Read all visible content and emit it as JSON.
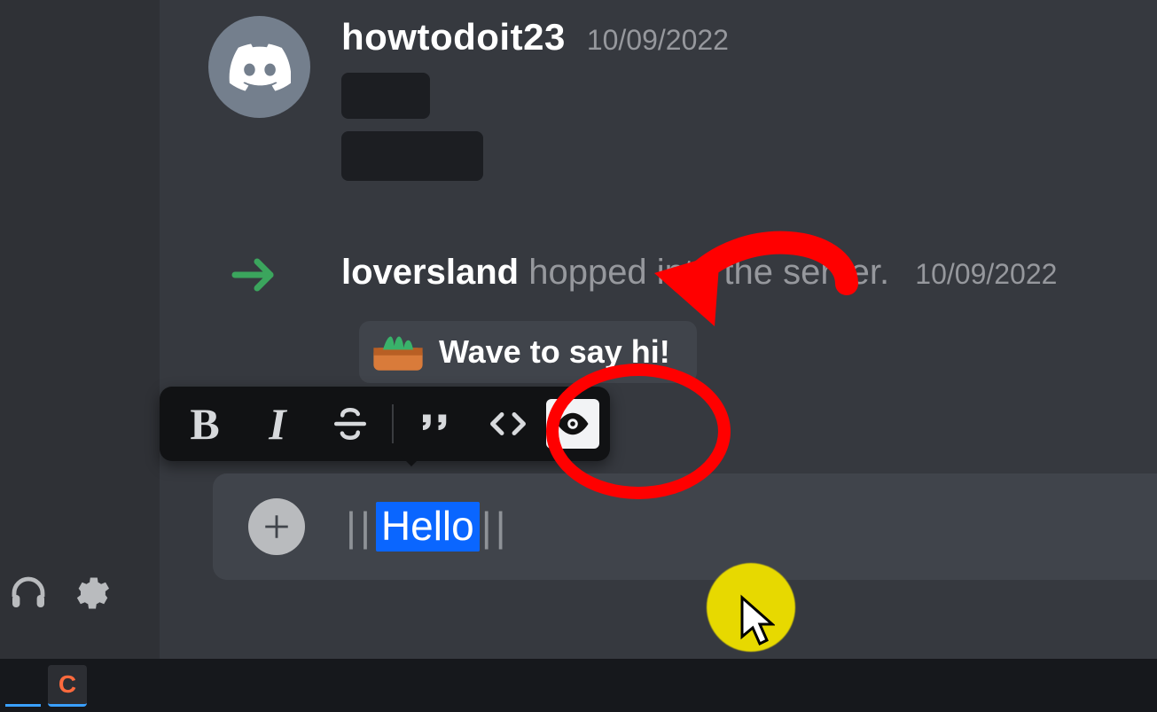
{
  "message1": {
    "username": "howtodoit23",
    "timestamp": "10/09/2022"
  },
  "system_join": {
    "username": "loversland",
    "action_text": "hopped into the server.",
    "timestamp": "10/09/2022",
    "wave_label": "Wave to say hi!"
  },
  "toolbar": {
    "bold": "B",
    "italic": "I"
  },
  "input": {
    "spoiler_open": "||",
    "text": "Hello",
    "spoiler_close": "||"
  },
  "taskbar": {
    "app_letter": "C"
  }
}
